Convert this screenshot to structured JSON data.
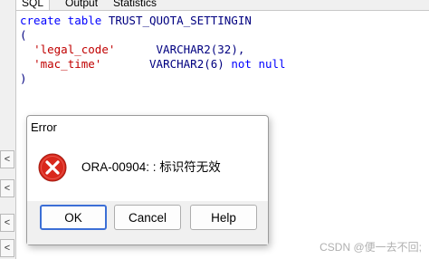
{
  "tabs": [
    {
      "label": "SQL"
    },
    {
      "label": "Output"
    },
    {
      "label": "Statistics"
    }
  ],
  "left_strip": {
    "buttons": [
      "<",
      "<",
      "<",
      "<"
    ]
  },
  "editor": {
    "line1_kw": "create table",
    "line1_name": "TRUST_QUOTA_SETTINGIN",
    "line2": "(",
    "line3_col": "'legal_code'",
    "line3_type": "VARCHAR2(32),",
    "line4_col": "'mac_time'",
    "line4_type": "VARCHAR2(6)",
    "line4_kw": "not null",
    "line5": ")"
  },
  "dialog": {
    "title": "Error",
    "message": "ORA-00904: : 标识符无效",
    "icon": "error-x-icon",
    "buttons": {
      "ok": "OK",
      "cancel": "Cancel",
      "help": "Help"
    }
  },
  "watermark": "CSDN @便一去不回;",
  "colors": {
    "keyword": "#0000ff",
    "string": "#c00000",
    "identifier": "#000080",
    "error_red": "#d9281c",
    "ok_focus": "#3c6fd6"
  }
}
